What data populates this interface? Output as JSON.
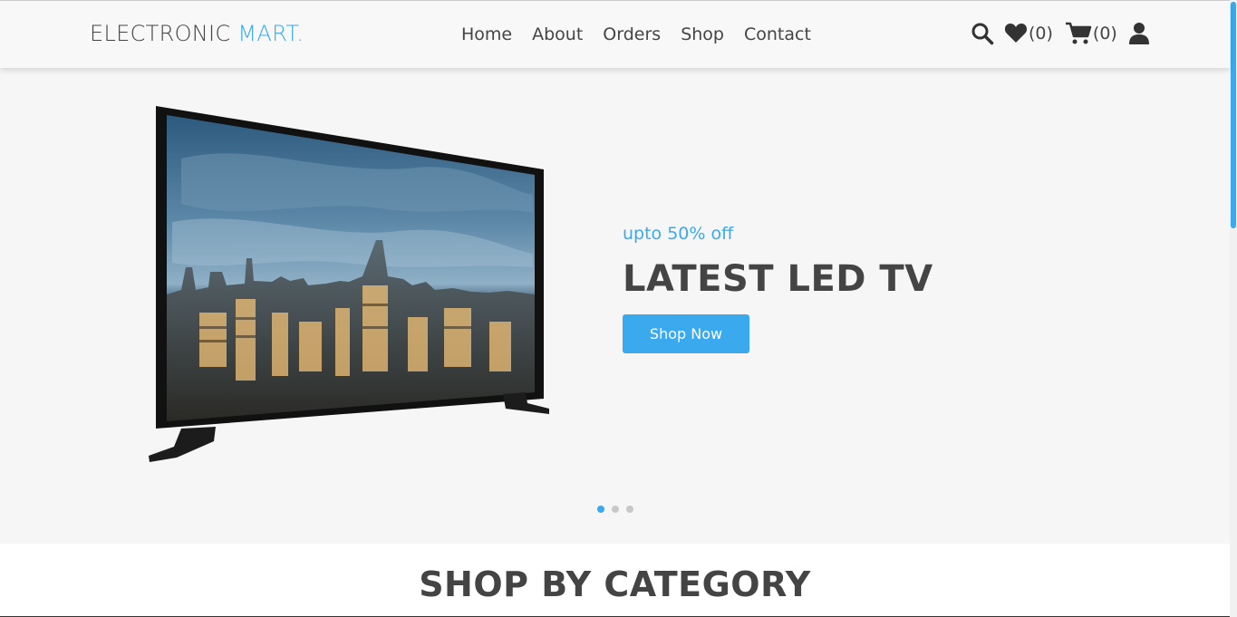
{
  "header": {
    "brand_main": "ELECTRONIC ",
    "brand_accent": "MART.",
    "nav": [
      "Home",
      "About",
      "Orders",
      "Shop",
      "Contact"
    ],
    "wishlist_count": "(0)",
    "cart_count": "(0)",
    "icons": [
      "search-icon",
      "heart-icon",
      "cart-icon",
      "user-icon"
    ]
  },
  "hero": {
    "offer": "upto 50% off",
    "title": "LATEST LED TV",
    "button": "Shop Now",
    "slides": 3,
    "active_slide": 1
  },
  "section": {
    "title": "SHOP BY CATEGORY"
  },
  "colors": {
    "accent": "#3aa9ee",
    "text": "#444444",
    "hero_bg": "#f6f6f6"
  }
}
